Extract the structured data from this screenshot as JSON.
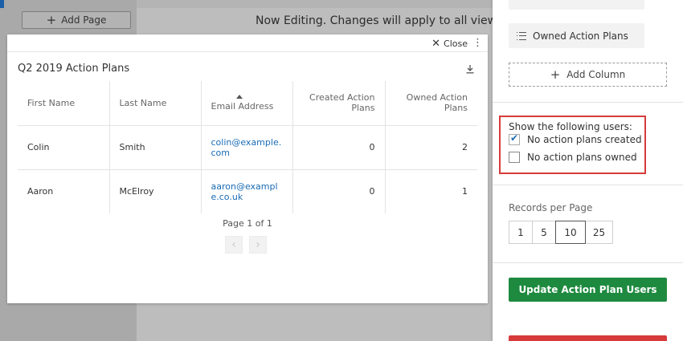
{
  "background": {
    "add_page_label": "Add Page",
    "editing_banner": "Now Editing. Changes will apply to all viewers of t"
  },
  "modal": {
    "close_label": "Close",
    "title": "Q2 2019 Action Plans",
    "columns": {
      "first_name": "First Name",
      "last_name": "Last Name",
      "email": "Email Address",
      "created": "Created Action Plans",
      "owned": "Owned Action Plans"
    },
    "rows": [
      {
        "first": "Colin",
        "last": "Smith",
        "email": "colin@example.com",
        "created": "0",
        "owned": "2"
      },
      {
        "first": "Aaron",
        "last": "McElroy",
        "email": "aaron@example.co.uk",
        "created": "0",
        "owned": "1"
      }
    ],
    "pager_text": "Page 1 of 1",
    "prev_glyph": "‹",
    "next_glyph": "›"
  },
  "panel": {
    "owned_chip_label": "Owned Action Plans",
    "add_column_label": "Add Column",
    "filter": {
      "title": "Show the following users:",
      "options": [
        {
          "label": "No action plans created",
          "checked": true
        },
        {
          "label": "No action plans owned",
          "checked": false
        }
      ]
    },
    "records_per_page": {
      "label": "Records per Page",
      "options": [
        "1",
        "5",
        "10",
        "25"
      ],
      "selected": "10"
    },
    "update_button": "Update Action Plan Users"
  },
  "colors": {
    "accent_green": "#1e8a3f",
    "link_blue": "#1a6cb5",
    "highlight_red": "#d63a3a"
  }
}
